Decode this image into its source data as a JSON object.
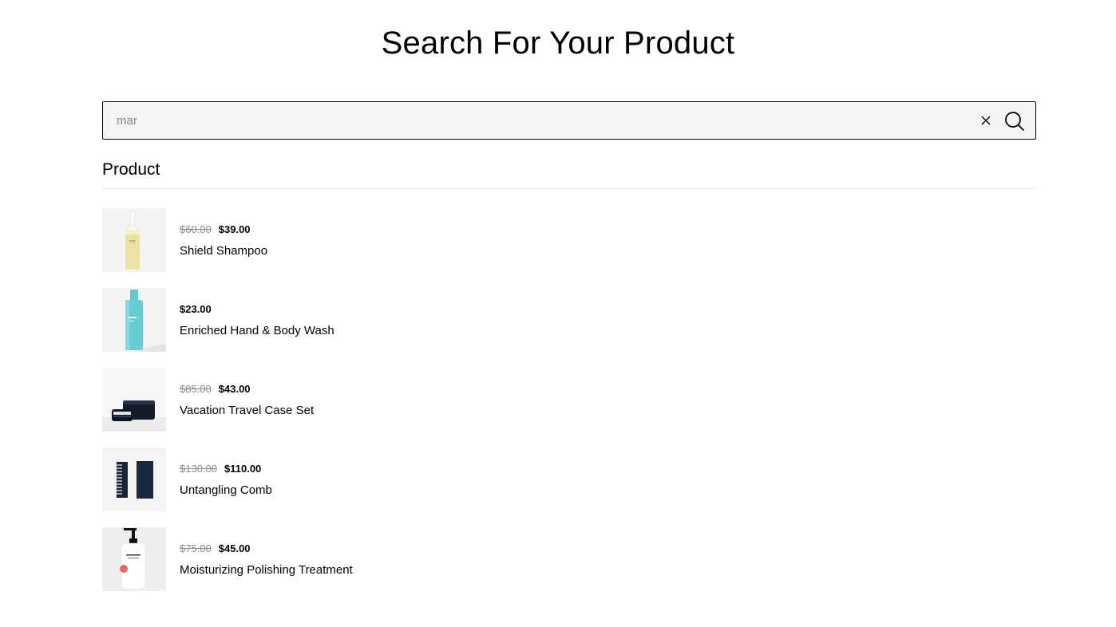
{
  "page": {
    "title": "Search For Your Product"
  },
  "search": {
    "value": "mar",
    "clear_icon": "close-icon",
    "search_icon": "search-icon"
  },
  "section": {
    "title": "Product"
  },
  "products": [
    {
      "old_price": "$60.00",
      "price": "$39.00",
      "name": "Shield Shampoo",
      "image": "shampoo-bottle"
    },
    {
      "old_price": "",
      "price": "$23.00",
      "name": "Enriched Hand & Body Wash",
      "image": "body-wash-bottle"
    },
    {
      "old_price": "$85.00",
      "price": "$43.00",
      "name": "Vacation Travel Case Set",
      "image": "travel-case"
    },
    {
      "old_price": "$130.00",
      "price": "$110.00",
      "name": "Untangling Comb",
      "image": "comb"
    },
    {
      "old_price": "$75.00",
      "price": "$45.00",
      "name": "Moisturizing Polishing Treatment",
      "image": "pump-bottle"
    }
  ]
}
